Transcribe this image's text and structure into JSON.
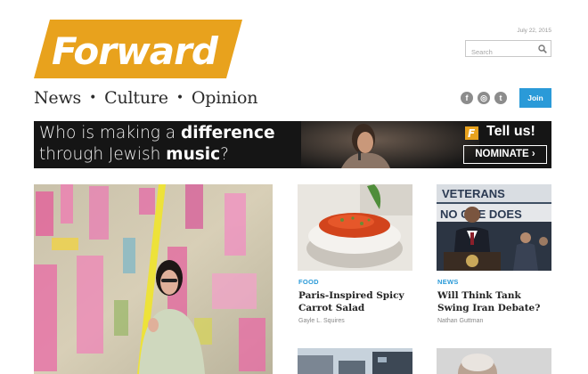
{
  "header": {
    "logo_text": "Forward",
    "date": "July 22, 2015",
    "search_placeholder": "Search",
    "join_label": "Join"
  },
  "nav": {
    "items": [
      "News",
      "Culture",
      "Opinion"
    ],
    "separator": "•"
  },
  "social": [
    "f",
    "◎",
    "t"
  ],
  "banner": {
    "line1_plain": "Who is making a ",
    "line1_bold": "difference",
    "line2_plain": "through Jewish ",
    "line2_bold": "music",
    "line2_end": "?",
    "tell_us": "Tell us!",
    "nominate": "NOMINATE ›"
  },
  "articles": [
    {
      "category": "FOOD",
      "title": "Paris-Inspired Spicy Carrot Salad",
      "author": "Gayle L. Squires"
    },
    {
      "category": "NEWS",
      "title": "Will Think Tank Swing Iran Debate?",
      "author": "Nathan Guttman"
    }
  ],
  "photo_texts": {
    "veterans_sign_line1": "VETERANS",
    "veterans_sign_line2": "NO ONE DOES"
  },
  "colors": {
    "brand_gold": "#e8a21d",
    "accent_blue": "#2a9ad8"
  }
}
